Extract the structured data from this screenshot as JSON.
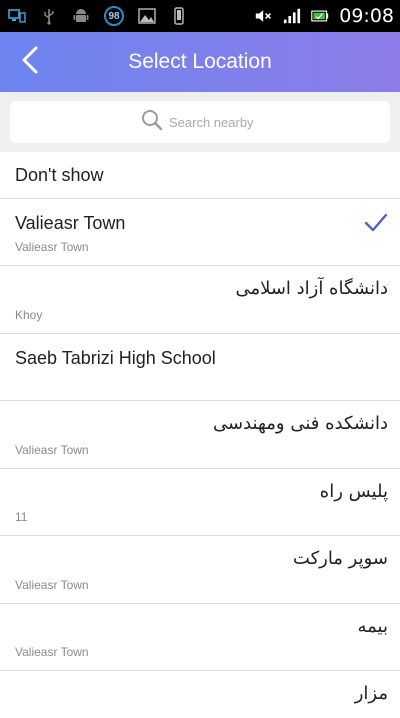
{
  "status_bar": {
    "time": "09:08",
    "badge_count": "98",
    "icons": [
      "monitor-phone-icon",
      "usb-icon",
      "android-icon",
      "notification-badge-icon",
      "image-icon",
      "phone-icon",
      "mute-icon",
      "signal-icon",
      "battery-icon"
    ]
  },
  "app_bar": {
    "title": "Select Location",
    "back_icon": "chevron-left-icon",
    "colors": {
      "start": "#6d84f0",
      "end": "#8c7de8"
    }
  },
  "search": {
    "placeholder": "Search nearby",
    "icon": "search-icon"
  },
  "list": {
    "items": [
      {
        "title": "Don't show",
        "subtitle": ""
      },
      {
        "title": "Valieasr Town",
        "subtitle": "Valieasr Town",
        "selected": true
      },
      {
        "title": "دانشگاه آزاد اسلامی",
        "subtitle": "Khoy"
      },
      {
        "title": "Saeb Tabrizi High School",
        "subtitle": ""
      },
      {
        "title": "دانشکده فنی ومهندسی",
        "subtitle": "Valieasr Town"
      },
      {
        "title": "پلیس راه",
        "subtitle": "11"
      },
      {
        "title": "سوپر مارکت",
        "subtitle": "Valieasr Town"
      },
      {
        "title": "بیمه",
        "subtitle": "Valieasr Town"
      },
      {
        "title": "مزار",
        "subtitle": ""
      }
    ],
    "check_color": "#5462c8"
  }
}
